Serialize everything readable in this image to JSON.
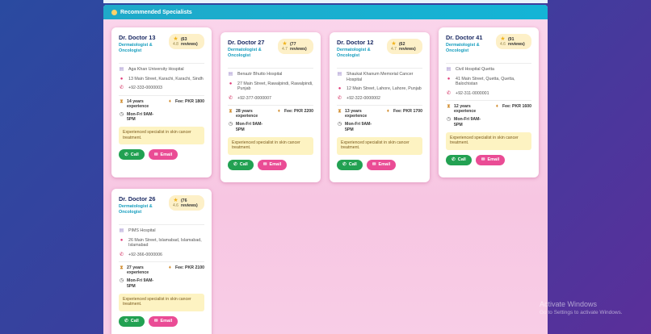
{
  "header": {
    "title": "Recommended Specialists",
    "icon": "doctor-icon"
  },
  "buttons": {
    "call": "Call",
    "email": "Email"
  },
  "doctors": [
    {
      "name": "Dr. Doctor 13",
      "specialty": "Dermatologist & Oncologist",
      "rating": "4.8",
      "reviews": "(63 reviews)",
      "hospital": "Aga Khan University Hospital",
      "address": "13 Main Street, Karachi, Karachi, Sindh",
      "phone": "+92-333-0000003",
      "experience": "14 years experience",
      "fee": "Fee: PKR 1800",
      "schedule": "Mon-Fri 9AM-5PM",
      "description": "Experienced specialist in skin cancer treatment."
    },
    {
      "name": "Dr. Doctor 27",
      "specialty": "Dermatologist & Oncologist",
      "rating": "4.7",
      "reviews": "(77 reviews)",
      "hospital": "Benazir Bhutto Hospital",
      "address": "27 Main Street, Rawalpindi, Rawalpindi, Punjab",
      "phone": "+92-377-0000007",
      "experience": "28 years experience",
      "fee": "Fee: PKR 2200",
      "schedule": "Mon-Fri 9AM-5PM",
      "description": "Experienced specialist in skin cancer treatment."
    },
    {
      "name": "Dr. Doctor 12",
      "specialty": "Dermatologist & Oncologist",
      "rating": "4.7",
      "reviews": "(62 reviews)",
      "hospital": "Shaukat Khanum Memorial Cancer Hospital",
      "address": "12 Main Street, Lahore, Lahore, Punjab",
      "phone": "+92-322-0000002",
      "experience": "13 years experience",
      "fee": "Fee: PKR 1700",
      "schedule": "Mon-Fri 9AM-5PM",
      "description": "Experienced specialist in skin cancer treatment."
    },
    {
      "name": "Dr. Doctor 41",
      "specialty": "Dermatologist & Oncologist",
      "rating": "4.6",
      "reviews": "(91 reviews)",
      "hospital": "Civil Hospital Quetta",
      "address": "41 Main Street, Quetta, Quetta, Balochistan",
      "phone": "+92-311-0000001",
      "experience": "12 years experience",
      "fee": "Fee: PKR 1600",
      "schedule": "Mon-Fri 9AM-5PM",
      "description": "Experienced specialist in skin cancer treatment."
    },
    {
      "name": "Dr. Doctor 26",
      "specialty": "Dermatologist & Oncologist",
      "rating": "4.6",
      "reviews": "(76 reviews)",
      "hospital": "PIMS Hospital",
      "address": "26 Main Street, Islamabad, Islamabad, Islamabad",
      "phone": "+92-366-0000006",
      "experience": "27 years experience",
      "fee": "Fee: PKR 2100",
      "schedule": "Mon-Fri 9AM-5PM",
      "description": "Experienced specialist in skin cancer treatment."
    }
  ],
  "watermark": {
    "line1": "Activate Windows",
    "line2": "Go to Settings to activate Windows."
  }
}
